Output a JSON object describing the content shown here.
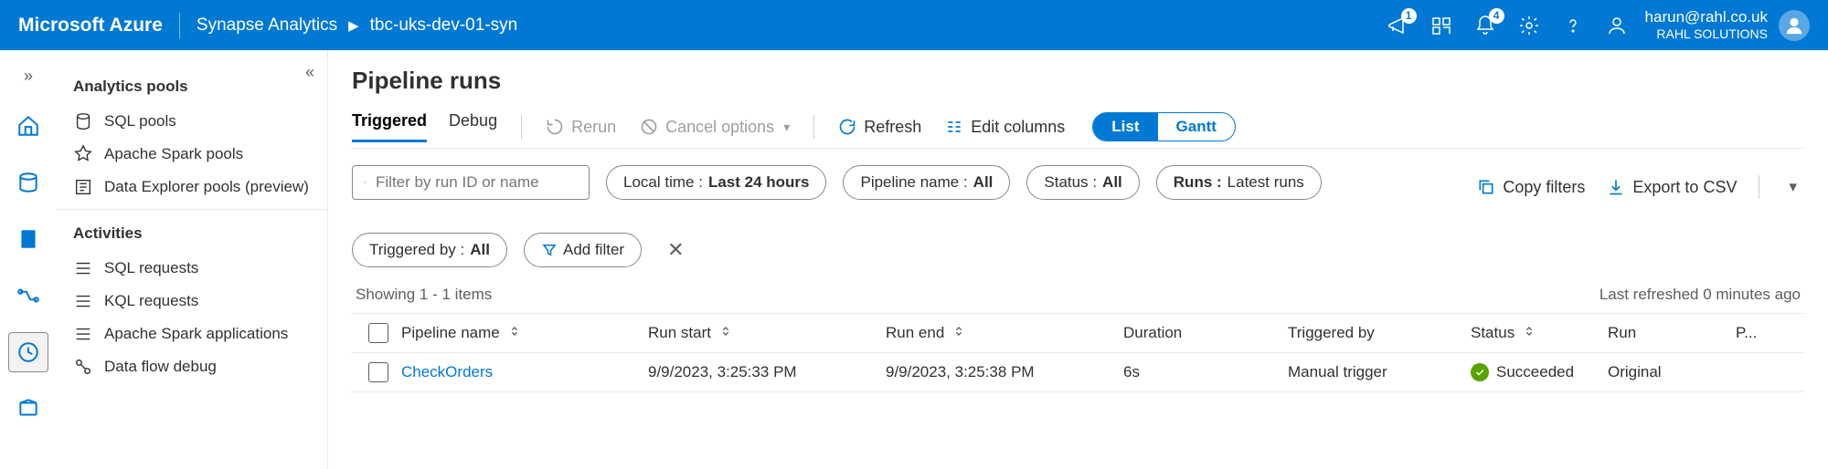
{
  "header": {
    "brand": "Microsoft Azure",
    "breadcrumb_root": "Synapse Analytics",
    "breadcrumb_current": "tbc-uks-dev-01-syn",
    "notif1_count": "1",
    "notif2_count": "4",
    "user_email": "harun@rahl.co.uk",
    "user_org": "RAHL SOLUTIONS"
  },
  "sidebar": {
    "section1": "Analytics pools",
    "items1": [
      "SQL pools",
      "Apache Spark pools",
      "Data Explorer pools (preview)"
    ],
    "section2": "Activities",
    "items2": [
      "SQL requests",
      "KQL requests",
      "Apache Spark applications",
      "Data flow debug"
    ]
  },
  "main": {
    "title": "Pipeline runs",
    "tabs": {
      "triggered": "Triggered",
      "debug": "Debug"
    },
    "toolbar": {
      "rerun": "Rerun",
      "cancel": "Cancel options",
      "refresh": "Refresh",
      "edit_cols": "Edit columns"
    },
    "view": {
      "list": "List",
      "gantt": "Gantt"
    },
    "filters": {
      "search_placeholder": "Filter by run ID or name",
      "time_label": "Local time : ",
      "time_value": "Last 24 hours",
      "pipe_label": "Pipeline name : ",
      "pipe_value": "All",
      "status_label": "Status : ",
      "status_value": "All",
      "runs_label": "Runs : ",
      "runs_value": "Latest runs",
      "trig_label": "Triggered by : ",
      "trig_value": "All",
      "add_filter": "Add filter"
    },
    "export": {
      "copy": "Copy filters",
      "csv": "Export to CSV"
    },
    "meta": {
      "showing": "Showing 1 - 1 items",
      "refreshed": "Last refreshed 0 minutes ago"
    },
    "columns": {
      "name": "Pipeline name",
      "start": "Run start",
      "end": "Run end",
      "duration": "Duration",
      "trig": "Triggered by",
      "status": "Status",
      "run": "Run",
      "p": "P..."
    },
    "rows": [
      {
        "name": "CheckOrders",
        "start": "9/9/2023, 3:25:33 PM",
        "end": "9/9/2023, 3:25:38 PM",
        "duration": "6s",
        "trig": "Manual trigger",
        "status": "Succeeded",
        "run": "Original"
      }
    ]
  }
}
